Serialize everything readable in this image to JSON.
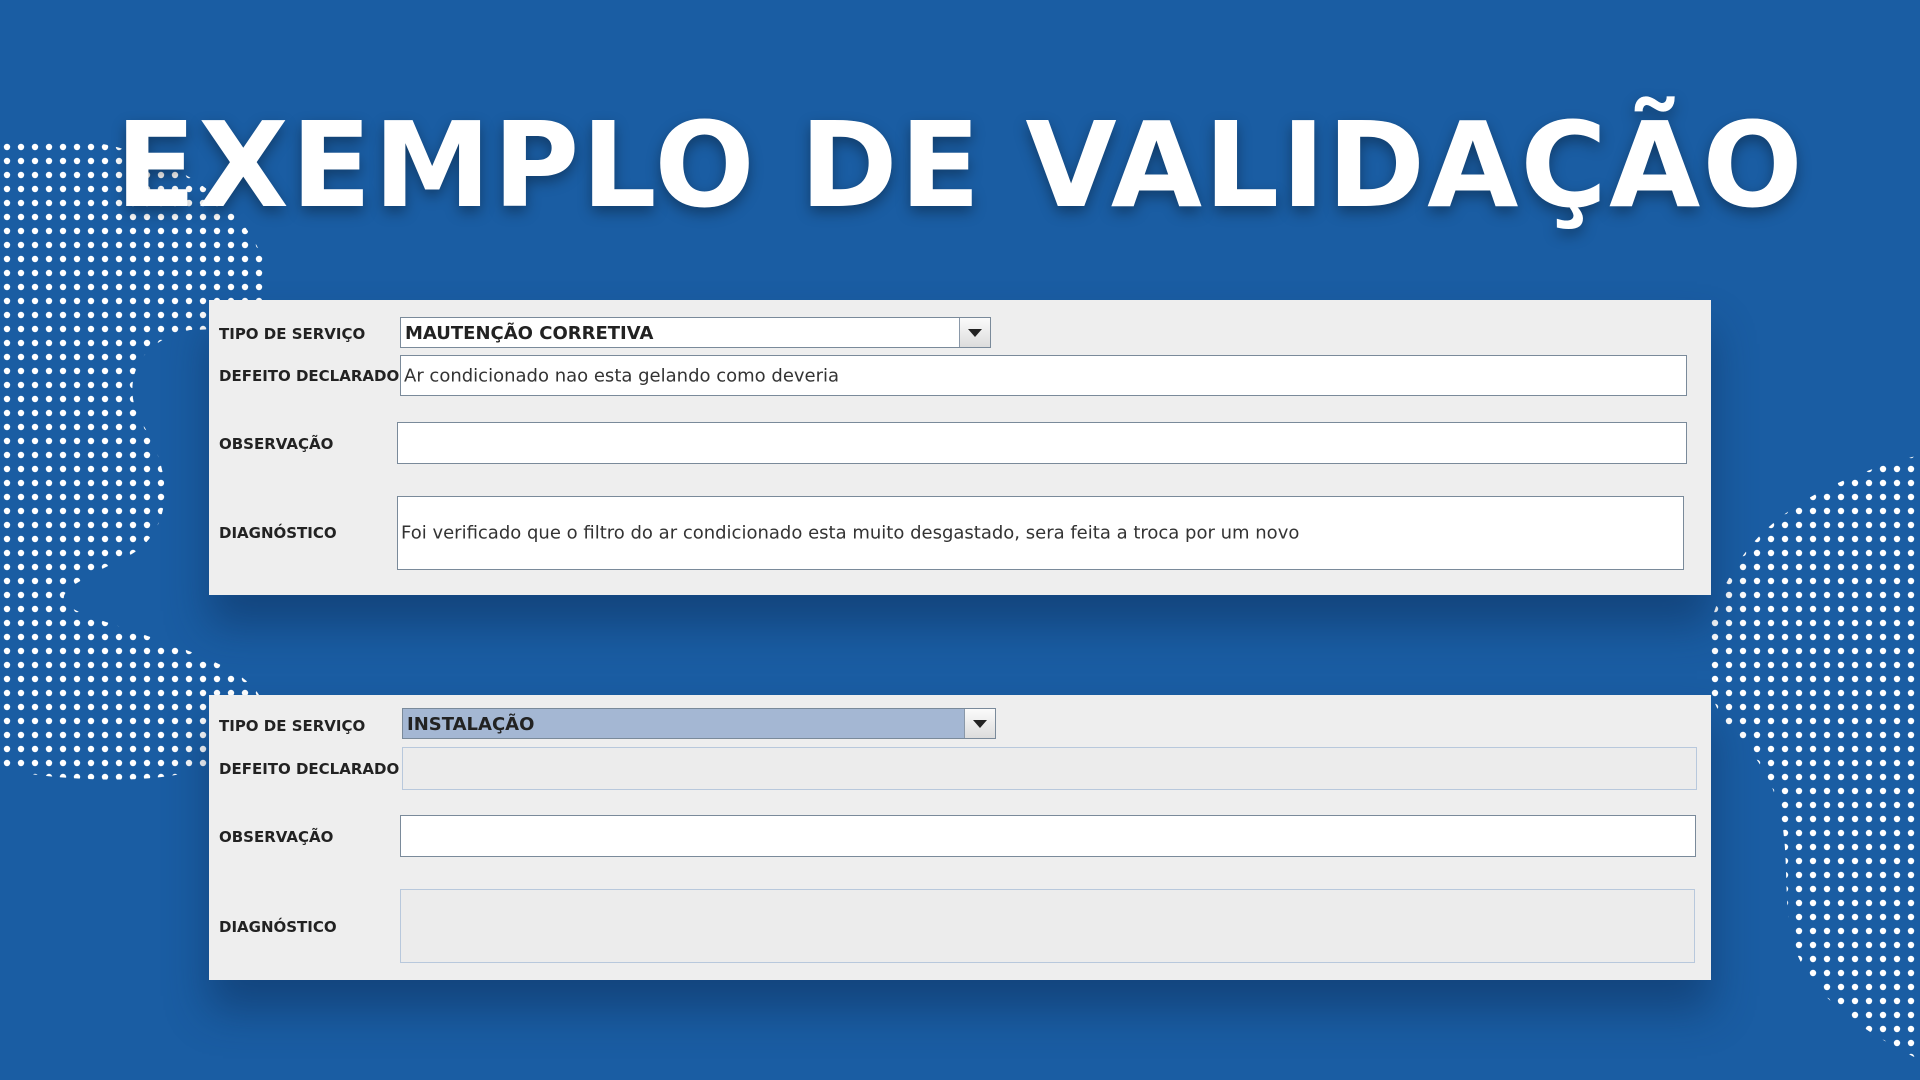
{
  "title": "EXEMPLO DE VALIDAÇÃO",
  "colors": {
    "background": "#1a5da3",
    "panel": "#eeeeee",
    "selected_combo": "#a4b7d3"
  },
  "form_filled": {
    "tipo_label": "TIPO DE SERVIÇO",
    "tipo_value": "MAUTENÇÃO CORRETIVA",
    "defeito_label": "DEFEITO DECLARADO",
    "defeito_value": "Ar condicionado nao esta gelando como deveria",
    "observacao_label": "OBSERVAÇÃO",
    "observacao_value": "",
    "diagnostico_label": "DIAGNÓSTICO",
    "diagnostico_value": "Foi verificado que o filtro do ar condicionado esta muito desgastado, sera feita a troca por um novo"
  },
  "form_installation": {
    "tipo_label": "TIPO DE SERVIÇO",
    "tipo_value": "INSTALAÇÃO",
    "defeito_label": "DEFEITO DECLARADO",
    "defeito_value": "",
    "defeito_enabled": false,
    "observacao_label": "OBSERVAÇÃO",
    "observacao_value": "",
    "diagnostico_label": "DIAGNÓSTICO",
    "diagnostico_value": "",
    "diagnostico_enabled": false
  }
}
